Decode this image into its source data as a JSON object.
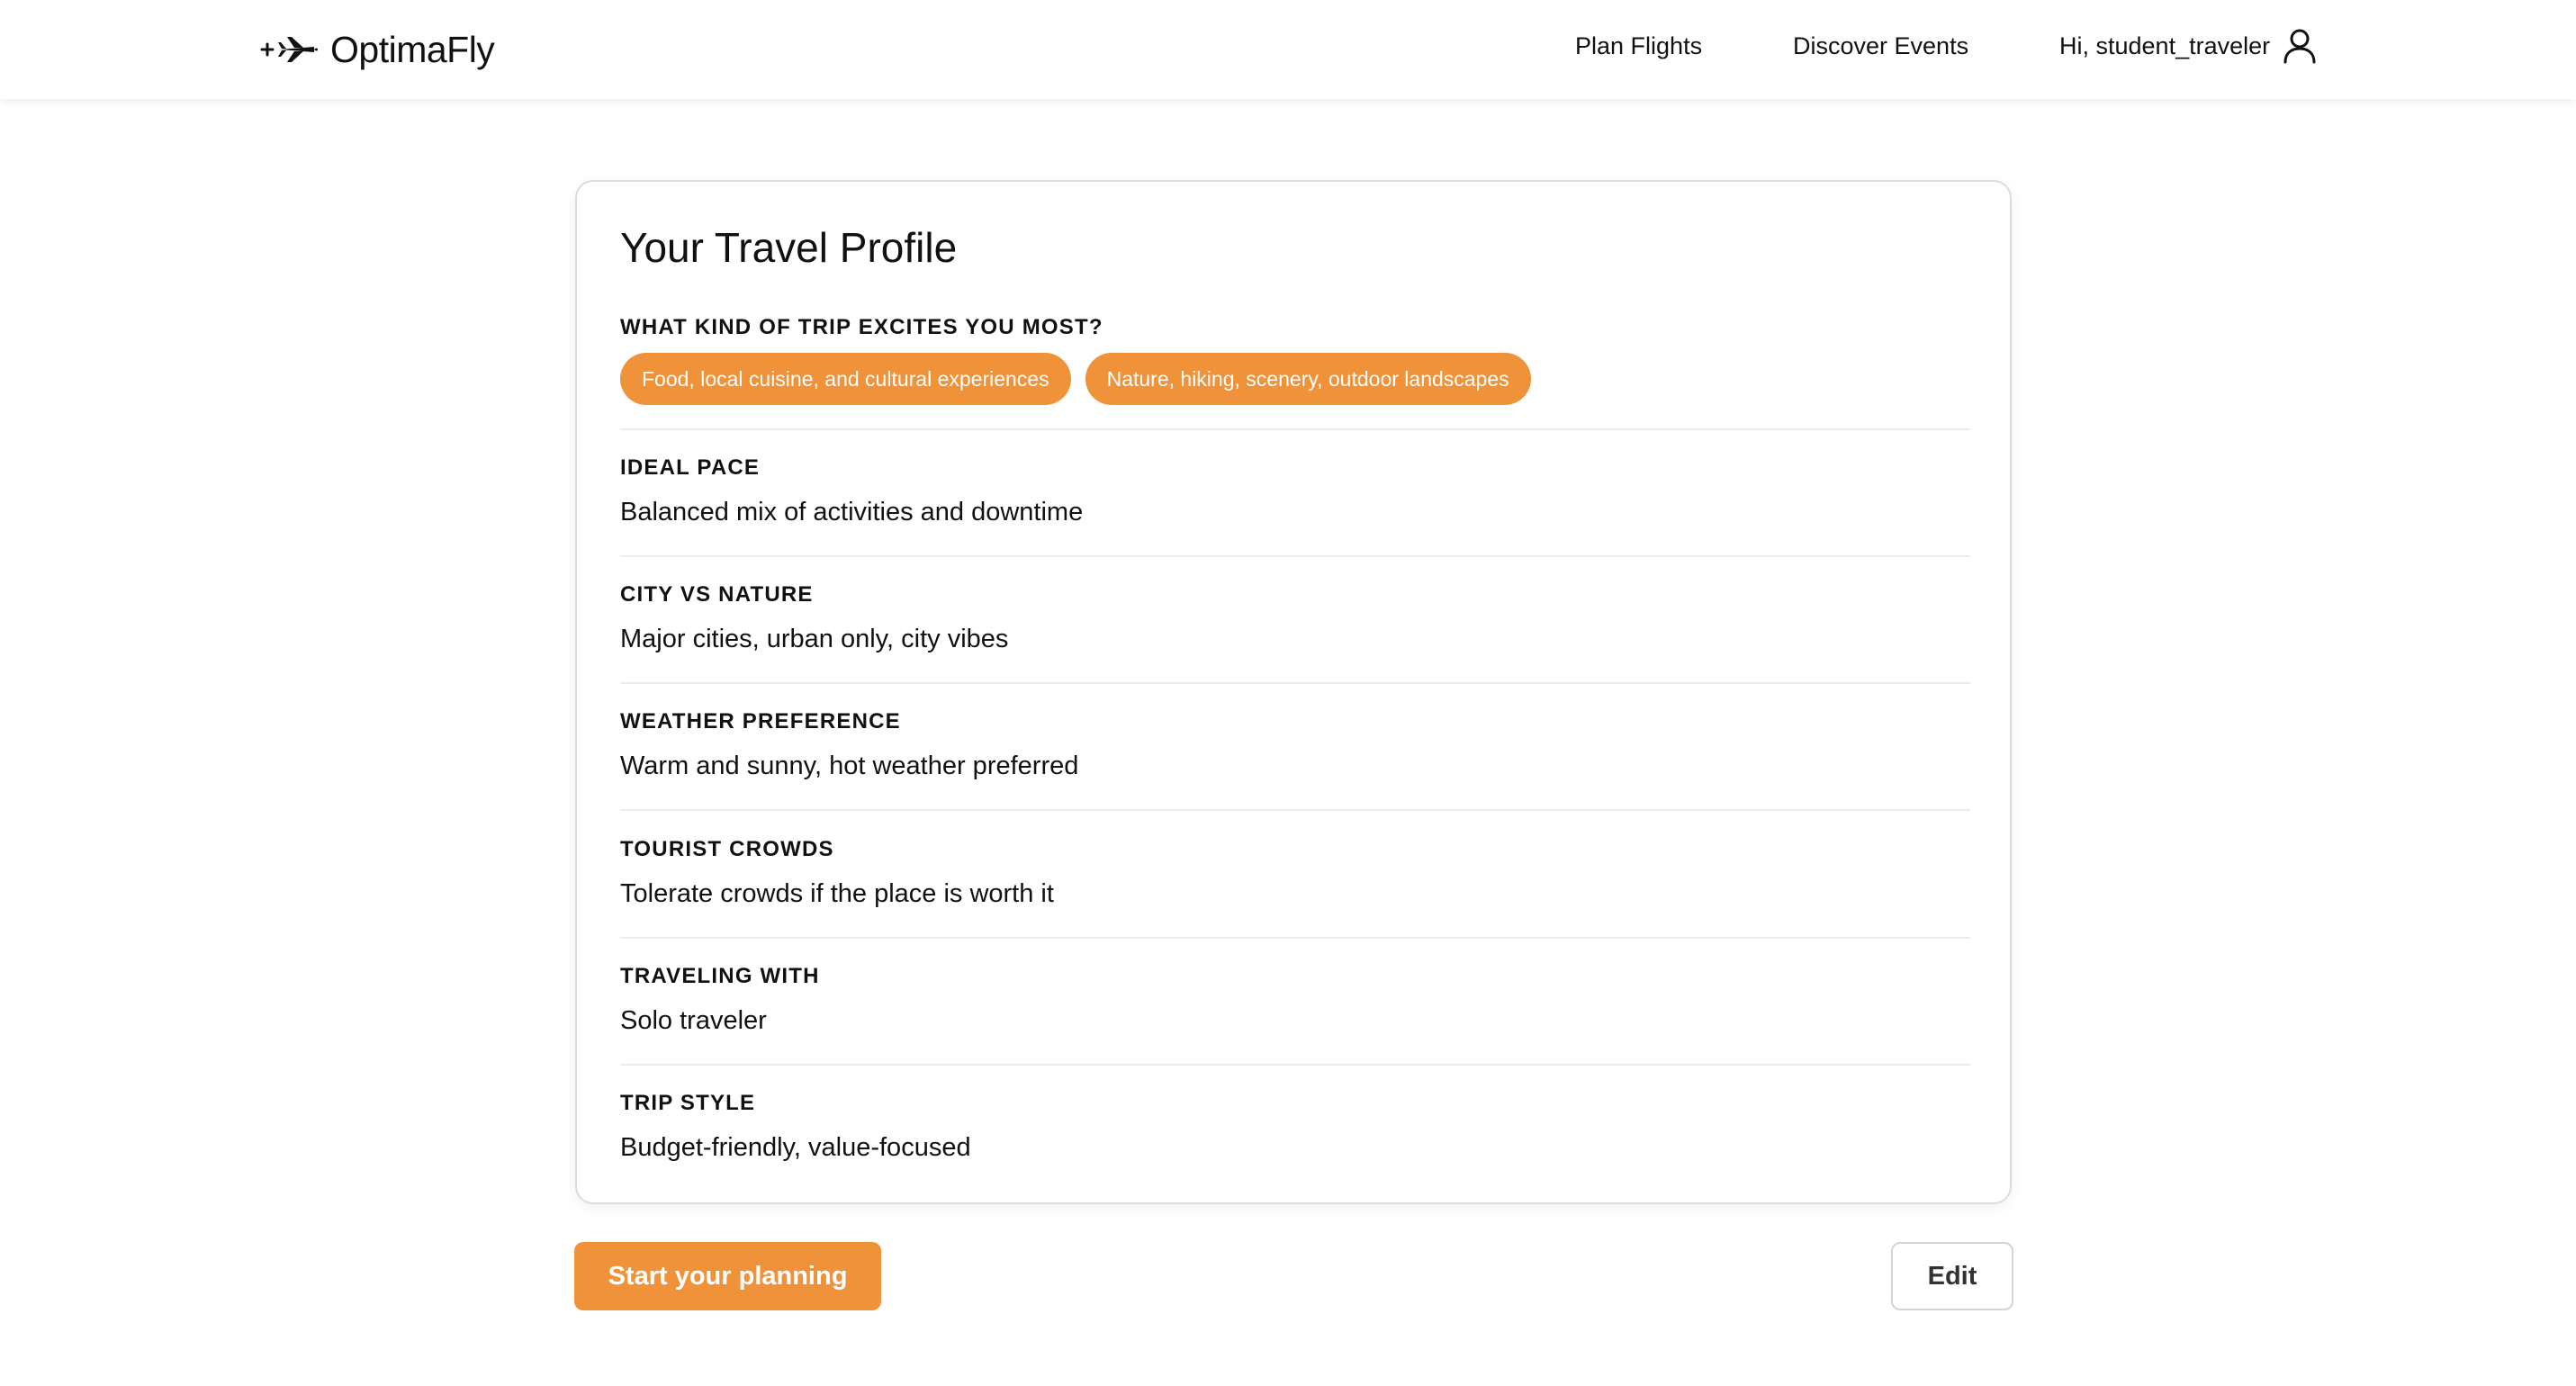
{
  "header": {
    "brand": "OptimaFly",
    "nav": {
      "plan_flights": "Plan Flights",
      "discover_events": "Discover Events",
      "greeting": "Hi, student_traveler"
    }
  },
  "profile": {
    "title": "Your Travel Profile",
    "trip_question": "WHAT KIND OF TRIP EXCITES YOU MOST?",
    "trip_tags": [
      "Food, local cuisine, and cultural experiences",
      "Nature, hiking, scenery, outdoor landscapes"
    ],
    "preferences": [
      {
        "label": "IDEAL PACE",
        "value": "Balanced mix of activities and downtime"
      },
      {
        "label": "CITY VS NATURE",
        "value": "Major cities, urban only, city vibes"
      },
      {
        "label": "WEATHER PREFERENCE",
        "value": "Warm and sunny, hot weather preferred"
      },
      {
        "label": "TOURIST CROWDS",
        "value": "Tolerate crowds if the place is worth it"
      },
      {
        "label": "TRAVELING WITH",
        "value": "Solo traveler"
      },
      {
        "label": "TRIP STYLE",
        "value": "Budget-friendly, value-focused"
      }
    ]
  },
  "actions": {
    "start_label": "Start your planning",
    "edit_label": "Edit"
  },
  "colors": {
    "accent": "#f0923a",
    "text": "#111111",
    "border": "#dcdcdc"
  },
  "icons": {
    "brand": "plane-icon",
    "user": "user-icon"
  }
}
